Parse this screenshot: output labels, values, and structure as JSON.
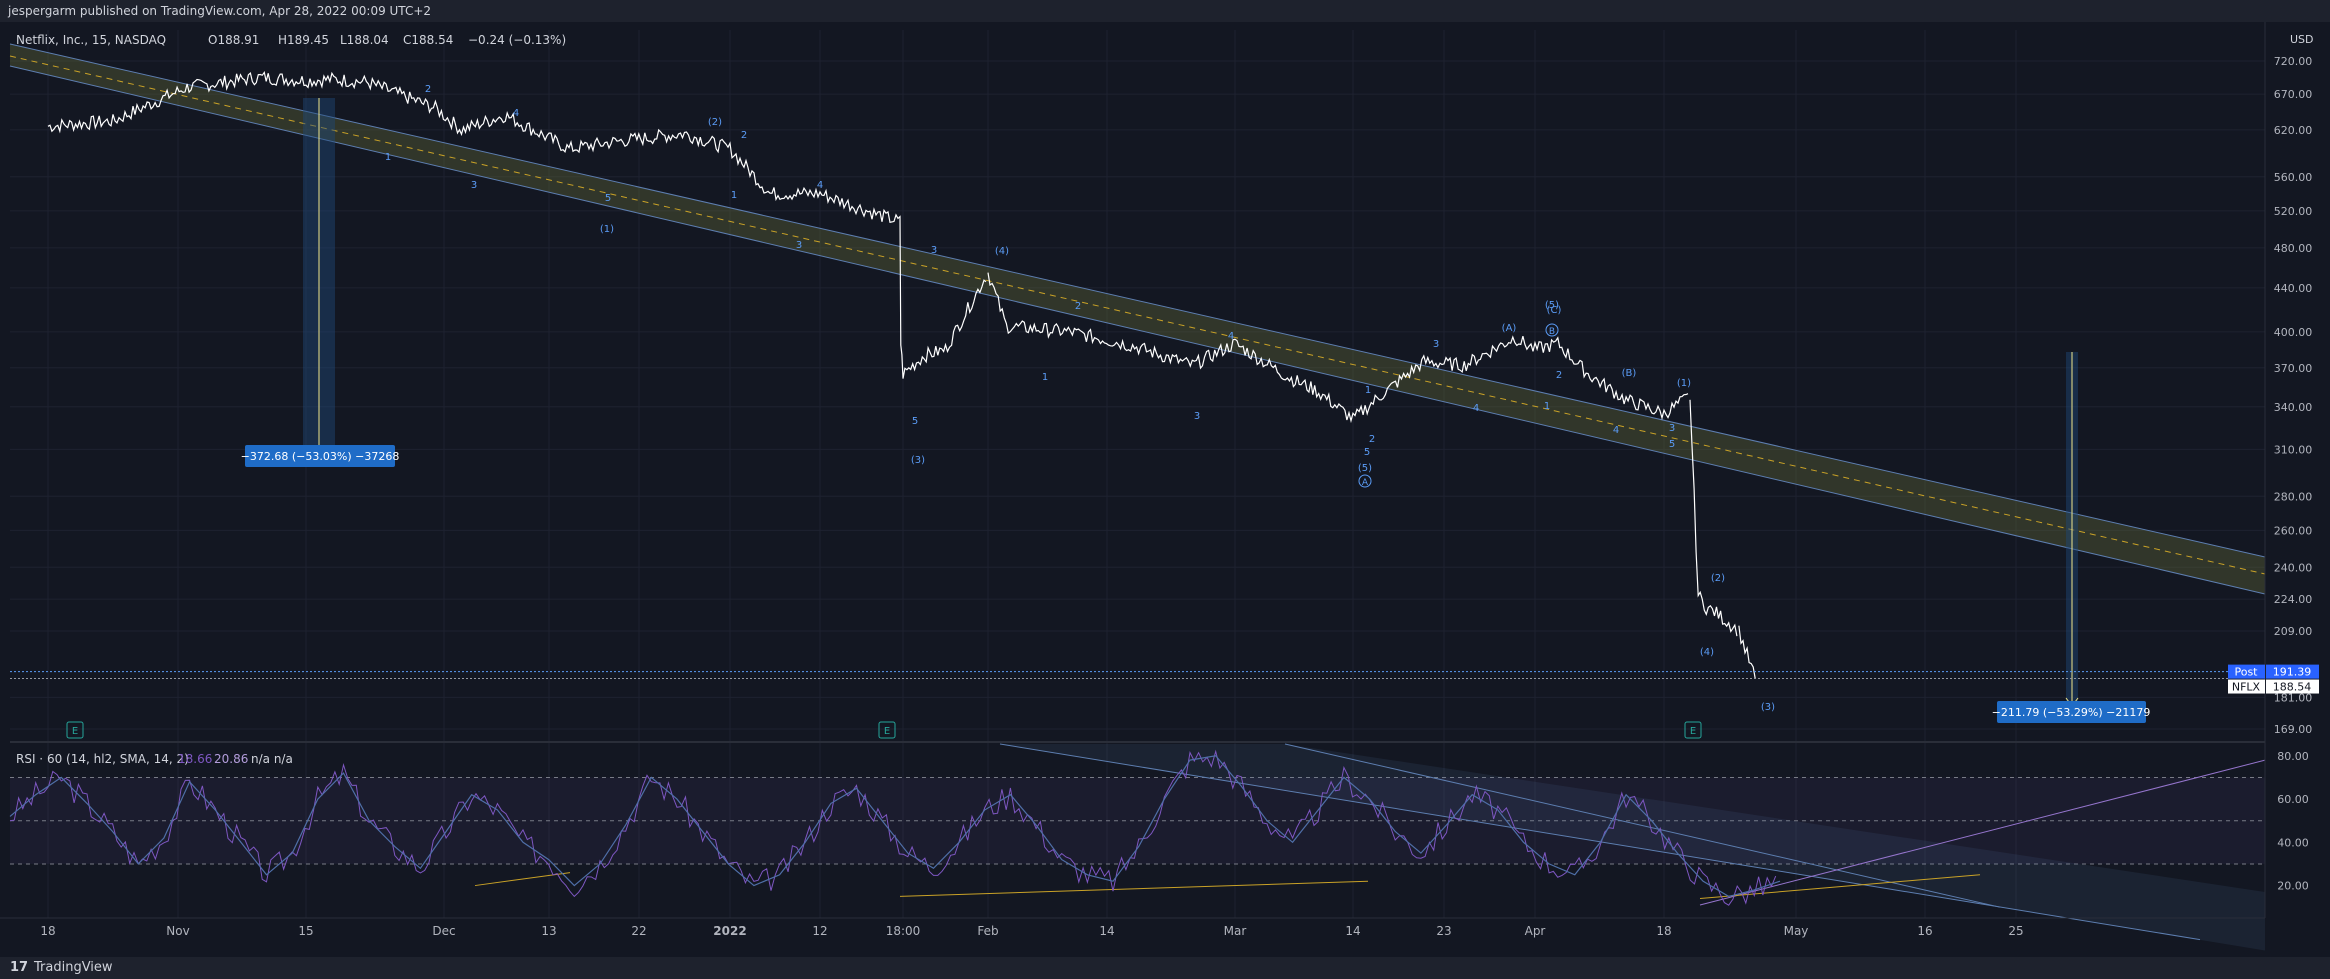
{
  "header": {
    "published": "jespergarm published on TradingView.com, Apr 28, 2022 00:09 UTC+2"
  },
  "legend": {
    "symbol": "Netflix, Inc., 15, NASDAQ",
    "o": "O188.91",
    "h": "H189.45",
    "l": "L188.04",
    "c": "C188.54",
    "chg": "−0.24 (−0.13%)"
  },
  "currency": "USD",
  "rsi_legend": {
    "name": "RSI · 60 (14, hl2, SMA, 14, 2)",
    "v1": "18.66",
    "v2": "20.86",
    "na": "n/a  n/a"
  },
  "footer": {
    "logo": "17",
    "brand": "TradingView"
  },
  "colors": {
    "bg": "#131722",
    "price": "#ffffff",
    "channel_line": "#5d7eb0",
    "channel_fill": "#6b6f3a",
    "mid": "#c9a227",
    "rsi": "#7e57c2",
    "wave": "#5b9cf6",
    "measure_box": "#1f6cc7"
  },
  "chart_data": {
    "type": "line",
    "price_axis": {
      "scale": "log",
      "ticks": [
        "720.00",
        "670.00",
        "620.00",
        "560.00",
        "520.00",
        "480.00",
        "440.00",
        "400.00",
        "370.00",
        "340.00",
        "310.00",
        "280.00",
        "260.00",
        "240.00",
        "224.00",
        "209.00",
        "181.00",
        "169.00"
      ],
      "ylim": [
        165,
        770
      ]
    },
    "time_axis": {
      "ticks": [
        "18",
        "Nov",
        "15",
        "Dec",
        "13",
        "22",
        "2022",
        "12",
        "18:00",
        "Feb",
        "14",
        "Mar",
        "14",
        "23",
        "Apr",
        "18",
        "May",
        "16",
        "25"
      ]
    },
    "series": [
      {
        "values": [
          {
            "x": "2021-10-18",
            "y": 625
          },
          {
            "x": "2021-10-25",
            "y": 632
          },
          {
            "x": "2021-11-02",
            "y": 680
          },
          {
            "x": "2021-11-10",
            "y": 695
          },
          {
            "x": "2021-11-15",
            "y": 690
          },
          {
            "x": "2021-11-18",
            "y": 692
          },
          {
            "x": "2021-11-22",
            "y": 688
          },
          {
            "x": "2021-11-30",
            "y": 650
          },
          {
            "x": "2021-12-03",
            "y": 620
          },
          {
            "x": "2021-12-08",
            "y": 640
          },
          {
            "x": "2021-12-15",
            "y": 595
          },
          {
            "x": "2021-12-20",
            "y": 605
          },
          {
            "x": "2021-12-28",
            "y": 615
          },
          {
            "x": "2022-01-03",
            "y": 595
          },
          {
            "x": "2022-01-07",
            "y": 540
          },
          {
            "x": "2022-01-12",
            "y": 540
          },
          {
            "x": "2022-01-18",
            "y": 515
          },
          {
            "x": "2022-01-20",
            "y": 508
          },
          {
            "x": "2022-01-21",
            "y": 390
          },
          {
            "x": "2022-01-24",
            "y": 365
          },
          {
            "x": "2022-01-26",
            "y": 380
          },
          {
            "x": "2022-01-28",
            "y": 385
          },
          {
            "x": "2022-02-01",
            "y": 455
          },
          {
            "x": "2022-02-03",
            "y": 405
          },
          {
            "x": "2022-02-10",
            "y": 400
          },
          {
            "x": "2022-02-17",
            "y": 388
          },
          {
            "x": "2022-02-24",
            "y": 372
          },
          {
            "x": "2022-03-01",
            "y": 390
          },
          {
            "x": "2022-03-07",
            "y": 362
          },
          {
            "x": "2022-03-10",
            "y": 352
          },
          {
            "x": "2022-03-14",
            "y": 331
          },
          {
            "x": "2022-03-17",
            "y": 350
          },
          {
            "x": "2022-03-21",
            "y": 375
          },
          {
            "x": "2022-03-25",
            "y": 372
          },
          {
            "x": "2022-03-30",
            "y": 395
          },
          {
            "x": "2022-04-01",
            "y": 385
          },
          {
            "x": "2022-04-04",
            "y": 390
          },
          {
            "x": "2022-04-08",
            "y": 365
          },
          {
            "x": "2022-04-13",
            "y": 345
          },
          {
            "x": "2022-04-18",
            "y": 335
          },
          {
            "x": "2022-04-19",
            "y": 348
          },
          {
            "x": "2022-04-20",
            "y": 226
          },
          {
            "x": "2022-04-21",
            "y": 220
          },
          {
            "x": "2022-04-22",
            "y": 218
          },
          {
            "x": "2022-04-25",
            "y": 209
          },
          {
            "x": "2022-04-27",
            "y": 188.54
          }
        ]
      }
    ],
    "price_labels": [
      {
        "name": "Post",
        "value": "191.39"
      },
      {
        "name": "NFLX",
        "value": "188.54"
      }
    ],
    "measurements": [
      "−372.68 (−53.03%) −37268",
      "−211.79 (−53.29%) −21179"
    ],
    "wave_labels": [
      "2",
      "4",
      "1",
      "3",
      "5",
      "(1)",
      "(2)",
      "2",
      "1",
      "3",
      "4",
      "3",
      "(4)",
      "2",
      "1",
      "5",
      "(3)",
      "4",
      "3",
      "1",
      "2",
      "5",
      "(5)",
      "A",
      "3",
      "4",
      "(A)",
      "B",
      "(C)",
      "2",
      "1",
      "(B)",
      "4",
      "3",
      "5",
      "(1)",
      "(2)",
      "(4)",
      "(3)",
      "(5)"
    ],
    "earnings_markers": [
      "E",
      "E",
      "E"
    ],
    "rsi": {
      "ticks": [
        "80.00",
        "60.00",
        "40.00",
        "20.00"
      ],
      "ylim": [
        5,
        85
      ],
      "bands": [
        70,
        50,
        30
      ],
      "values": [
        52,
        62,
        70,
        58,
        45,
        30,
        42,
        68,
        55,
        40,
        25,
        35,
        60,
        72,
        50,
        38,
        28,
        45,
        62,
        55,
        40,
        32,
        20,
        30,
        48,
        70,
        60,
        45,
        30,
        20,
        25,
        40,
        58,
        65,
        50,
        35,
        28,
        40,
        55,
        62,
        48,
        32,
        25,
        22,
        38,
        60,
        78,
        80,
        66,
        50,
        40,
        55,
        70,
        60,
        45,
        35,
        48,
        62,
        55,
        40,
        30,
        25,
        40,
        62,
        50,
        35,
        22,
        15,
        18,
        22
      ]
    }
  }
}
